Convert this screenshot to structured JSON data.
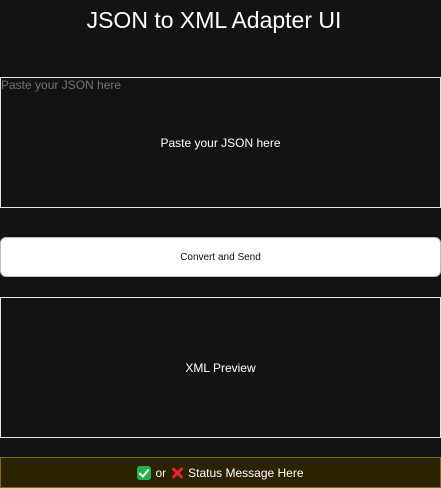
{
  "header": {
    "title": "JSON to XML Adapter UI"
  },
  "json_input": {
    "value": "",
    "placeholder": "Paste your JSON here"
  },
  "convert_button": {
    "label": "Convert and Send"
  },
  "xml_preview": {
    "label": "XML Preview"
  },
  "status": {
    "success_icon": "check-mark-icon",
    "separator": "or",
    "error_icon": "cross-mark-icon",
    "message": "Status Message Here",
    "colors": {
      "background": "#2c2100",
      "border": "#7a6a10",
      "success": "#23b14d",
      "error": "#e8222b"
    }
  }
}
